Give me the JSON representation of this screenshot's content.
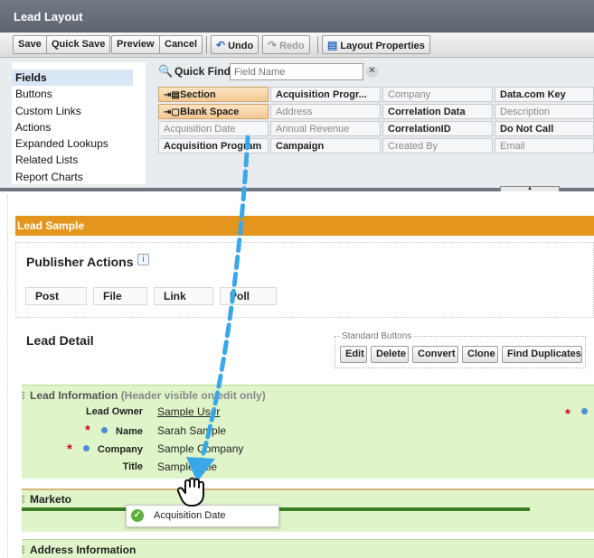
{
  "window": {
    "title": "Lead Layout"
  },
  "toolbar": {
    "save": "Save",
    "quick_save": "Quick Save",
    "preview": "Preview",
    "cancel": "Cancel",
    "undo": "Undo",
    "redo": "Redo",
    "layout_properties": "Layout Properties"
  },
  "palette": {
    "categories": [
      "Fields",
      "Buttons",
      "Custom Links",
      "Actions",
      "Expanded Lookups",
      "Related Lists",
      "Report Charts"
    ],
    "quick_find_label": "Quick Find",
    "quick_find_placeholder": "Field Name",
    "fields": [
      [
        "Section",
        "Acquisition Progr...",
        "Company",
        "Data.com Key"
      ],
      [
        "Blank Space",
        "Address",
        "Correlation Data",
        "Description"
      ],
      [
        "Acquisition Date",
        "Annual Revenue",
        "CorrelationID",
        "Do Not Call"
      ],
      [
        "Acquisition Program",
        "Campaign",
        "Created By",
        "Email"
      ]
    ]
  },
  "layout": {
    "sample_title": "Lead Sample",
    "publisher_actions_title": "Publisher Actions",
    "publisher_actions": [
      "Post",
      "File",
      "Link",
      "Poll"
    ],
    "lead_detail_title": "Lead Detail",
    "standard_buttons_label": "Standard Buttons",
    "standard_buttons": [
      "Edit",
      "Delete",
      "Convert",
      "Clone",
      "Find Duplicates"
    ],
    "lead_info_header": "Lead Information",
    "lead_info_note": "(Header visible on edit only)",
    "rows": [
      {
        "label": "Lead Owner",
        "value": "Sample User"
      },
      {
        "label": "Name",
        "value": "Sarah Sample"
      },
      {
        "label": "Company",
        "value": "Sample Company"
      },
      {
        "label": "Title",
        "value": "Sample Title"
      }
    ],
    "marketo_header": "Marketo",
    "address_header": "Address Information",
    "drag_item": "Acquisition Date"
  },
  "colors": {
    "accent": "#e4951e",
    "section_bg": "#dff5c9",
    "drag_arrow": "#3aa8e8",
    "required": "#d0021b"
  }
}
